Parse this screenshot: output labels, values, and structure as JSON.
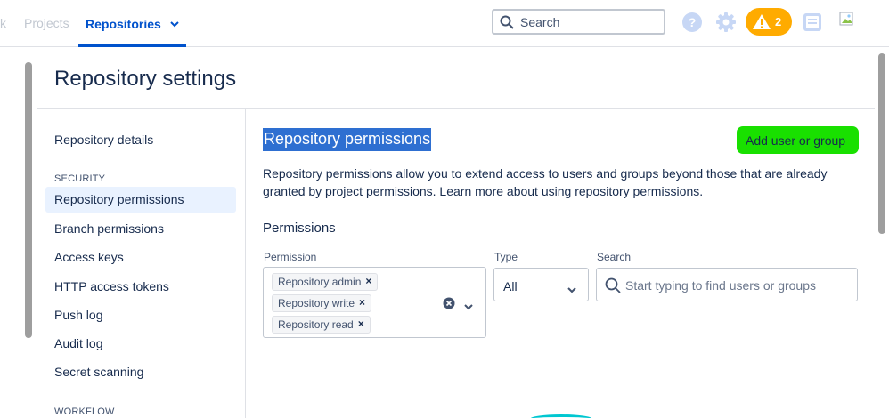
{
  "topnav": {
    "partial_item": "k",
    "projects_label": "Projects",
    "repositories_label": "Repositories",
    "search_placeholder": "Search",
    "alerts_count": "2"
  },
  "page": {
    "title": "Repository settings"
  },
  "sidebar": {
    "repository_details": "Repository details",
    "security_heading": "SECURITY",
    "security_items": [
      "Repository permissions",
      "Branch permissions",
      "Access keys",
      "HTTP access tokens",
      "Push log",
      "Audit log",
      "Secret scanning"
    ],
    "workflow_heading": "WORKFLOW"
  },
  "content": {
    "title": "Repository permissions",
    "add_button": "Add user or group",
    "description": "Repository permissions allow you to extend access to users and groups beyond those that are already granted by project permissions. Learn more about using repository permissions.",
    "permissions_heading": "Permissions",
    "labels": {
      "permission": "Permission",
      "type": "Type",
      "search": "Search"
    },
    "selected_permissions": [
      "Repository admin",
      "Repository write",
      "Repository read"
    ],
    "type_value": "All",
    "search_placeholder": "Start typing to find users or groups"
  },
  "colors": {
    "accent": "#0052cc",
    "highlight_title": "#2e6fd1",
    "add_button_bg": "#19e000",
    "alert_badge": "#ffab00",
    "active_item_bg": "#e9f2ff"
  }
}
